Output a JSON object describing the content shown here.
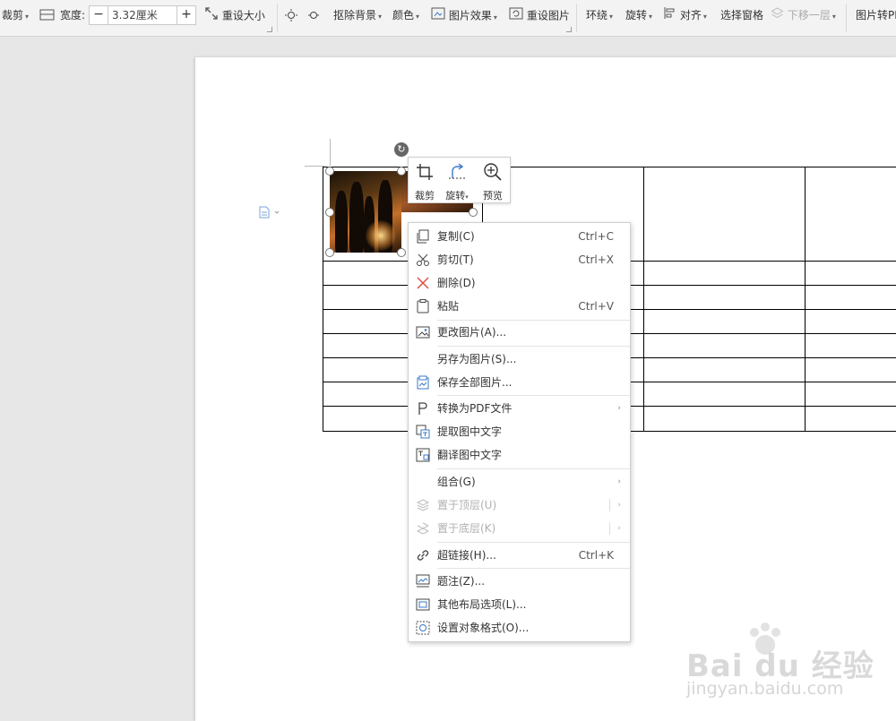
{
  "toolbar": {
    "crop_label": "裁剪",
    "width_label": "宽度:",
    "width_minus": "−",
    "width_value": "3.32厘米",
    "width_plus": "+",
    "reset_size_label": "重设大小",
    "remove_bg_label": "抠除背景",
    "color_label": "颜色",
    "effects_label": "图片效果",
    "reset_pic_label": "重设图片",
    "wrap_label": "环绕",
    "rotate_label": "旋转",
    "align_label": "对齐",
    "select_pane_label": "选择窗格",
    "send_backward_label": "下移一层",
    "pic_to_pdf_label": "图片转PDF"
  },
  "quickbar": {
    "crop": "裁剪",
    "rotate": "旋转",
    "preview": "预览"
  },
  "rotate_glyph": "↻",
  "menu": {
    "copy": {
      "label": "复制(C)",
      "shortcut": "Ctrl+C"
    },
    "cut": {
      "label": "剪切(T)",
      "shortcut": "Ctrl+X"
    },
    "delete": {
      "label": "删除(D)"
    },
    "paste": {
      "label": "粘贴",
      "shortcut": "Ctrl+V"
    },
    "change_pic": {
      "label": "更改图片(A)..."
    },
    "save_as_pic": {
      "label": "另存为图片(S)..."
    },
    "save_all_pics": {
      "label": "保存全部图片..."
    },
    "convert_pdf": {
      "label": "转换为PDF文件"
    },
    "extract_text": {
      "label": "提取图中文字"
    },
    "translate_text": {
      "label": "翻译图中文字"
    },
    "group": {
      "label": "组合(G)"
    },
    "bring_top": {
      "label": "置于顶层(U)"
    },
    "send_bottom": {
      "label": "置于底层(K)"
    },
    "hyperlink": {
      "label": "超链接(H)...",
      "shortcut": "Ctrl+K"
    },
    "caption": {
      "label": "题注(Z)..."
    },
    "layout_opts": {
      "label": "其他布局选项(L)..."
    },
    "format_obj": {
      "label": "设置对象格式(O)..."
    },
    "submenu_arrow": "›"
  },
  "watermark": {
    "logo": "Bai du 经验",
    "url": "jingyan.baidu.com"
  },
  "colors": {
    "ribbon_bg": "#f3f3f3",
    "canvas_bg": "#e7e7e7",
    "delete_icon": "#e0463c",
    "accent_icon": "#3a78c8"
  }
}
